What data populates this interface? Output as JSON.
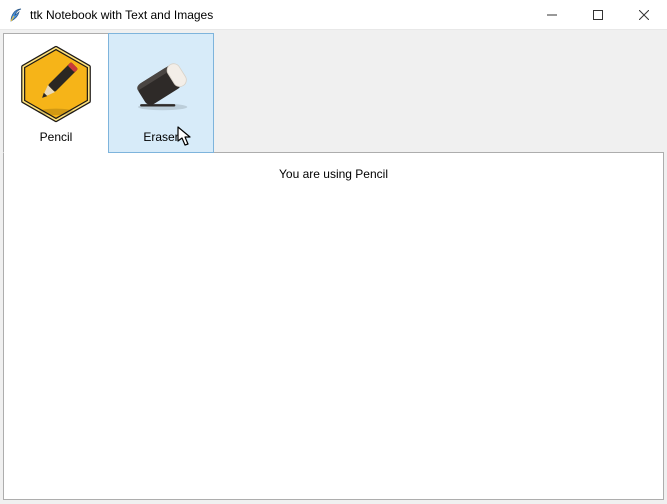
{
  "window": {
    "title": "ttk Notebook with Text and Images"
  },
  "tabs": [
    {
      "label": "Pencil"
    },
    {
      "label": "Eraser"
    }
  ],
  "body": {
    "message": "You are using Pencil"
  }
}
